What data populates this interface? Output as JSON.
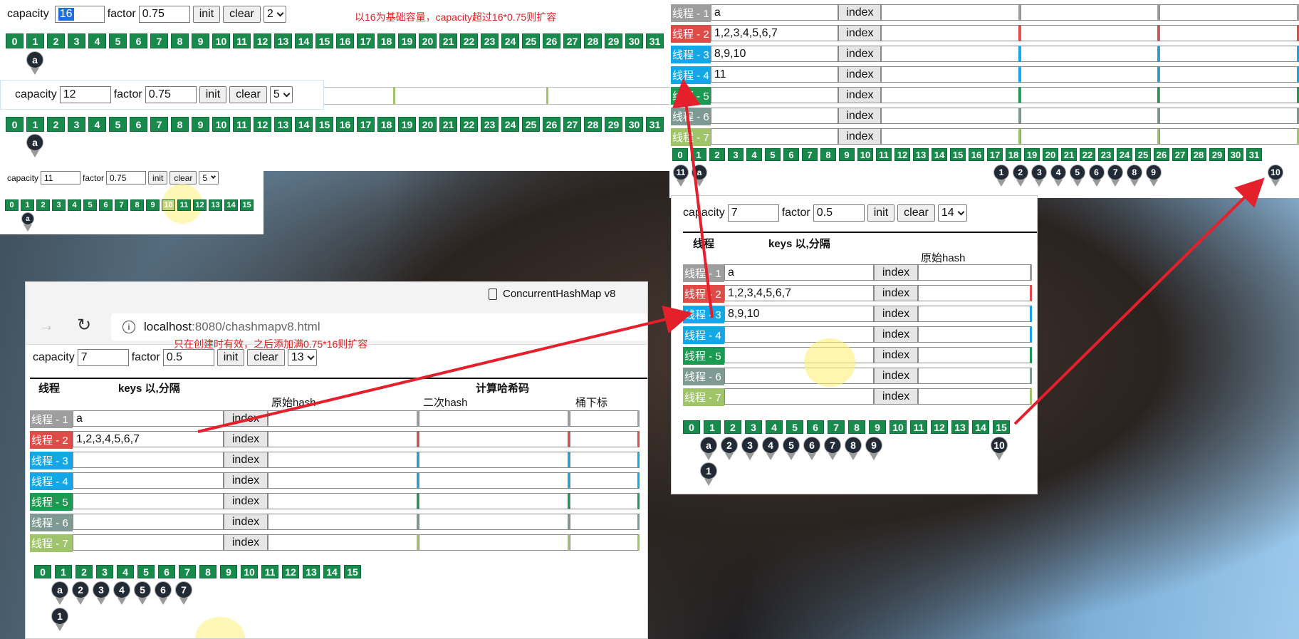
{
  "top_panel": {
    "capacity_label": "capacity",
    "capacity_value": "16",
    "factor_label": "factor",
    "factor_value": "0.75",
    "init": "init",
    "clear": "clear",
    "select_value": "2",
    "note": "以16为基础容量，capacity超过16*0.75则扩容",
    "buckets": [
      "0",
      "1",
      "2",
      "3",
      "4",
      "5",
      "6",
      "7",
      "8",
      "9",
      "10",
      "11",
      "12",
      "13",
      "14",
      "15",
      "16",
      "17",
      "18",
      "19",
      "20",
      "21",
      "22",
      "23",
      "24",
      "25",
      "26",
      "27",
      "28",
      "29",
      "30",
      "31"
    ],
    "pins": [
      "a"
    ]
  },
  "second_panel": {
    "capacity_label": "capacity",
    "capacity_value": "12",
    "factor_label": "factor",
    "factor_value": "0.75",
    "init": "init",
    "clear": "clear",
    "select_value": "5",
    "buckets": [
      "0",
      "1",
      "2",
      "3",
      "4",
      "5",
      "6",
      "7",
      "8",
      "9",
      "10",
      "11",
      "12",
      "13",
      "14",
      "15",
      "16",
      "17",
      "18",
      "19",
      "20",
      "21",
      "22",
      "23",
      "24",
      "25",
      "26",
      "27",
      "28",
      "29",
      "30",
      "31"
    ],
    "pins": [
      "a"
    ]
  },
  "third_panel": {
    "capacity_label": "capacity",
    "capacity_value": "11",
    "factor_label": "factor",
    "factor_value": "0.75",
    "init": "init",
    "clear": "clear",
    "select_value": "5",
    "buckets": [
      "0",
      "1",
      "2",
      "3",
      "4",
      "5",
      "6",
      "7",
      "8",
      "9",
      "10",
      "11",
      "12",
      "13",
      "14",
      "15"
    ],
    "pins": [
      "a"
    ]
  },
  "browser": {
    "tab_title": "ConcurrentHashMap v8",
    "url_host": "localhost",
    "url_rest": ":8080/chashmapv8.html",
    "note": "只在创建时有效，之后添加满0.75*16则扩容",
    "capacity_label": "capacity",
    "capacity_value": "7",
    "factor_label": "factor",
    "factor_value": "0.5",
    "init": "init",
    "clear": "clear",
    "select_value": "13",
    "headers": {
      "thread": "线程",
      "keys": "keys 以,分隔",
      "compute": "计算哈希码",
      "orig_hash": "原始hash",
      "second_hash": "二次hash",
      "bucket_index": "桶下标"
    },
    "rows": [
      {
        "tag": "线程 - 1",
        "keys": "a",
        "btn": "index"
      },
      {
        "tag": "线程 - 2",
        "keys": "1,2,3,4,5,6,7",
        "btn": "index"
      },
      {
        "tag": "线程 - 3",
        "keys": "",
        "btn": "index"
      },
      {
        "tag": "线程 - 4",
        "keys": "",
        "btn": "index"
      },
      {
        "tag": "线程 - 5",
        "keys": "",
        "btn": "index"
      },
      {
        "tag": "线程 - 6",
        "keys": "",
        "btn": "index"
      },
      {
        "tag": "线程 - 7",
        "keys": "",
        "btn": "index"
      }
    ],
    "buckets": [
      "0",
      "1",
      "2",
      "3",
      "4",
      "5",
      "6",
      "7",
      "8",
      "9",
      "10",
      "11",
      "12",
      "13",
      "14",
      "15"
    ],
    "pins_row1": [
      "a",
      "2",
      "3",
      "4",
      "5",
      "6",
      "7"
    ],
    "pins_row2": [
      "1"
    ]
  },
  "right_top_panel": {
    "rows": [
      {
        "tag": "线程 - 1",
        "keys": "a",
        "btn": "index"
      },
      {
        "tag": "线程 - 2",
        "keys": "1,2,3,4,5,6,7",
        "btn": "index"
      },
      {
        "tag": "线程 - 3",
        "keys": "8,9,10",
        "btn": "index"
      },
      {
        "tag": "线程 - 4",
        "keys": "11",
        "btn": "index"
      },
      {
        "tag": "线程 - 5",
        "keys": "",
        "btn": "index"
      },
      {
        "tag": "线程 - 6",
        "keys": "",
        "btn": "index"
      },
      {
        "tag": "线程 - 7",
        "keys": "",
        "btn": "index"
      }
    ],
    "buckets": [
      "0",
      "1",
      "2",
      "3",
      "4",
      "5",
      "6",
      "7",
      "8",
      "9",
      "10",
      "11",
      "12",
      "13",
      "14",
      "15",
      "16",
      "17",
      "18",
      "19",
      "20",
      "21",
      "22",
      "23",
      "24",
      "25",
      "26",
      "27",
      "28",
      "29",
      "30",
      "31"
    ],
    "pins_left": [
      "11",
      "a"
    ],
    "pins_mid": [
      "1",
      "2",
      "3",
      "4",
      "5",
      "6",
      "7",
      "8",
      "9"
    ],
    "pins_right": [
      "10"
    ]
  },
  "right_mid_panel": {
    "capacity_label": "capacity",
    "capacity_value": "7",
    "factor_label": "factor",
    "factor_value": "0.5",
    "init": "init",
    "clear": "clear",
    "select_value": "14",
    "headers": {
      "thread": "线程",
      "keys": "keys 以,分隔",
      "orig_hash": "原始hash"
    },
    "rows": [
      {
        "tag": "线程 - 1",
        "keys": "a",
        "btn": "index"
      },
      {
        "tag": "线程 - 2",
        "keys": "1,2,3,4,5,6,7",
        "btn": "index"
      },
      {
        "tag": "线程 - 3",
        "keys": "8,9,10",
        "btn": "index"
      },
      {
        "tag": "线程 - 4",
        "keys": "",
        "btn": "index"
      },
      {
        "tag": "线程 - 5",
        "keys": "",
        "btn": "index"
      },
      {
        "tag": "线程 - 6",
        "keys": "",
        "btn": "index"
      },
      {
        "tag": "线程 - 7",
        "keys": "",
        "btn": "index"
      }
    ],
    "buckets": [
      "0",
      "1",
      "2",
      "3",
      "4",
      "5",
      "6",
      "7",
      "8",
      "9",
      "10",
      "11",
      "12",
      "13",
      "14",
      "15"
    ],
    "pins_row1": [
      "a",
      "2",
      "3",
      "4",
      "5",
      "6",
      "7",
      "8",
      "9"
    ],
    "pins_row2": [
      "1"
    ],
    "pin_right": "10"
  }
}
